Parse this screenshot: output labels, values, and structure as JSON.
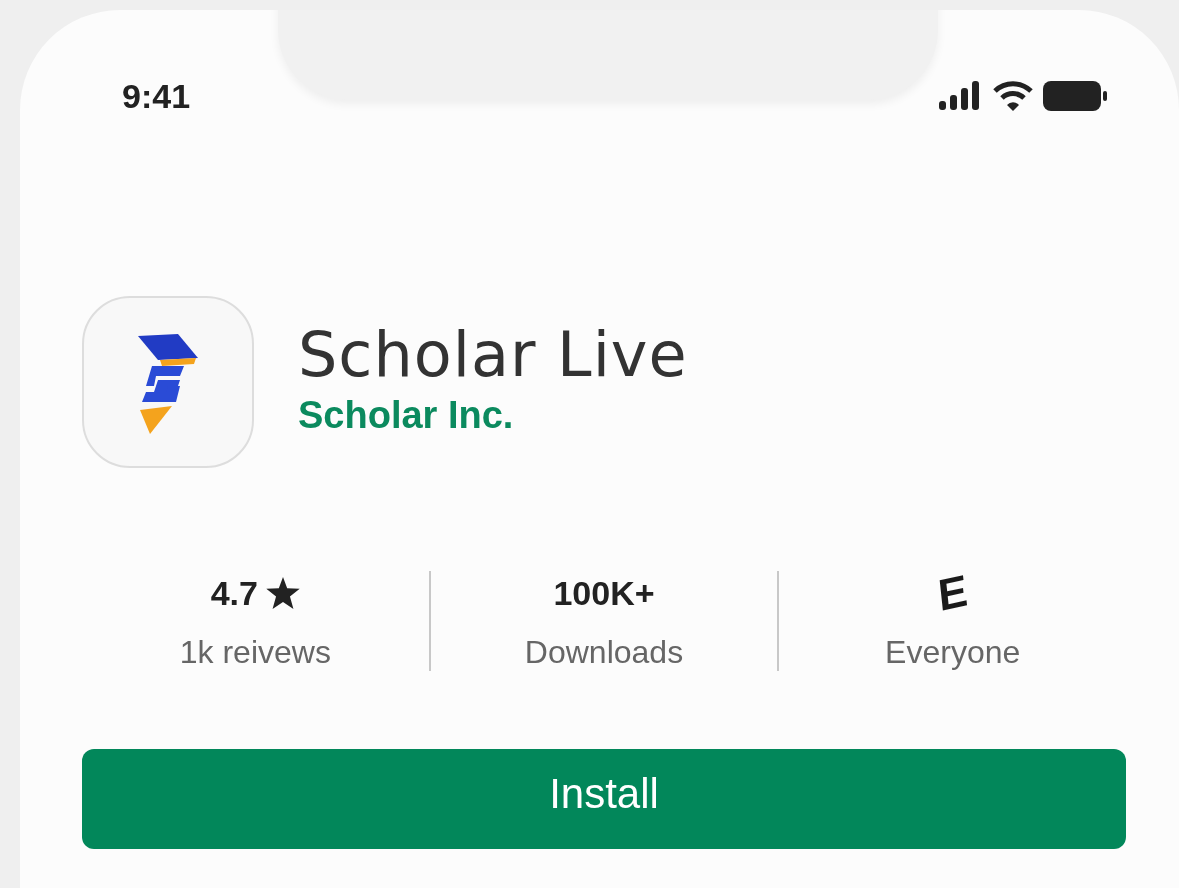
{
  "status_bar": {
    "time": "9:41"
  },
  "app": {
    "name": "Scholar Live",
    "developer": "Scholar Inc."
  },
  "stats": [
    {
      "kind": "rating",
      "value": "4.7",
      "label": "1k reivews"
    },
    {
      "kind": "plain",
      "value": "100K+",
      "label": "Downloads"
    },
    {
      "kind": "badge",
      "value": "E",
      "label": "Everyone"
    }
  ],
  "install_button": "Install"
}
